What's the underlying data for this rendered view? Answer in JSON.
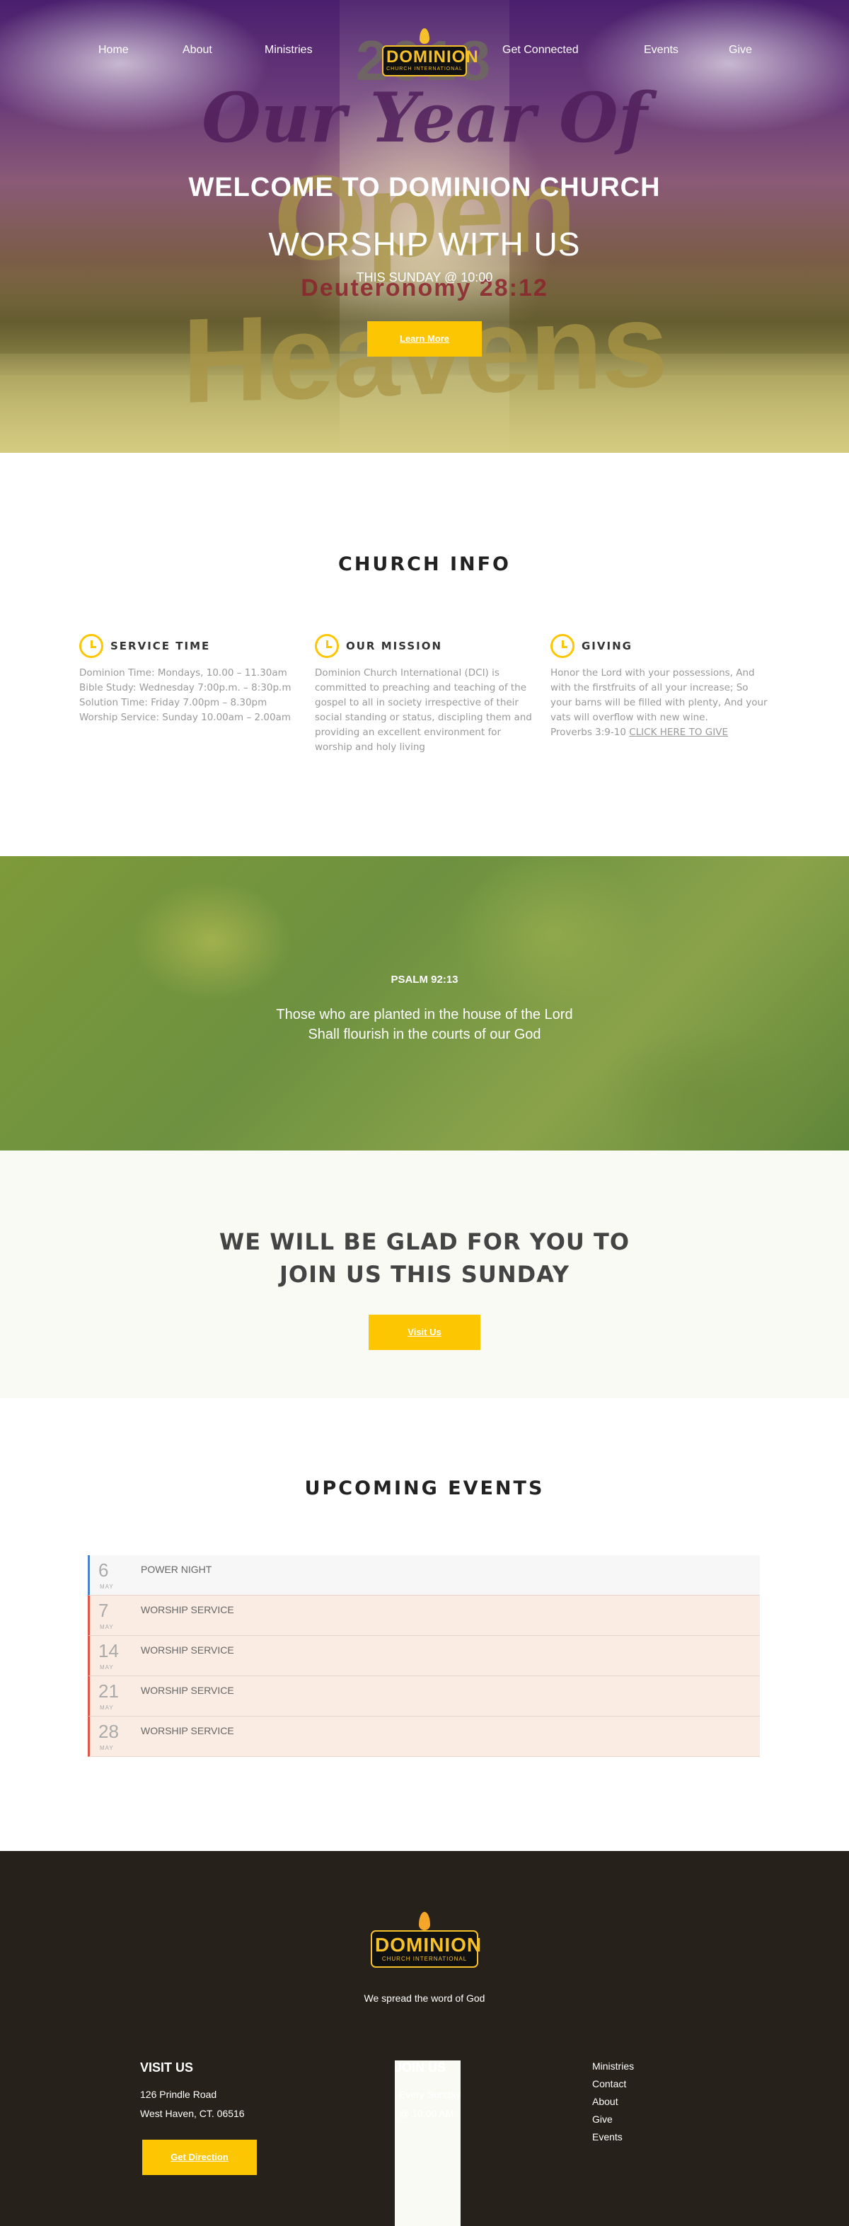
{
  "nav": {
    "home": "Home",
    "about": "About",
    "ministries": "Ministries",
    "get_connected": "Get Connected",
    "events": "Events",
    "give": "Give"
  },
  "logo": {
    "word": "DOMINION",
    "sub": "CHURCH INTERNATIONAL"
  },
  "hero": {
    "banner_year": "2018",
    "banner_script": "Our Year Of",
    "banner_title": "Open Heavens",
    "banner_verse": "Deuteronomy 28:12",
    "welcome": "WELCOME TO DOMINION CHURCH",
    "worship": "WORSHIP WITH US",
    "sunday": "THIS SUNDAY @ 10:00",
    "button": "Learn More"
  },
  "info": {
    "title": "CHURCH INFO",
    "service": {
      "heading": "SERVICE TIME",
      "lines": [
        "Dominion Time: Mondays, 10.00 – 11.30am",
        "Bible Study: Wednesday 7:00p.m. – 8:30p.m",
        "Solution Time: Friday 7.00pm – 8.30pm",
        "Worship Service: Sunday 10.00am – 2.00am"
      ]
    },
    "mission": {
      "heading": "OUR MISSION",
      "text": "Dominion Church International (DCI) is committed to preaching and teaching of the gospel to all in society irrespective of their social standing or status, discipling them and providing an excellent environment for worship and holy living"
    },
    "giving": {
      "heading": "GIVING",
      "text": "Honor the Lord with your possessions, And with the firstfruits of all your increase; So your barns will be filled with plenty, And your vats will overflow with new wine.",
      "ref": "Proverbs 3:9-10",
      "link": "CLICK HERE TO GIVE"
    }
  },
  "psalm": {
    "ref": "PSALM 92:13",
    "line1": "Those who are planted in the house of the Lord",
    "line2": "Shall flourish in the courts of our God"
  },
  "join": {
    "line1": "WE WILL BE GLAD FOR YOU TO",
    "line2": "JOIN US THIS SUNDAY",
    "button": "Visit Us"
  },
  "events": {
    "title": "UPCOMING EVENTS",
    "items": [
      {
        "day": "6",
        "month": "MAY",
        "name": "POWER NIGHT"
      },
      {
        "day": "7",
        "month": "MAY",
        "name": "WORSHIP SERVICE"
      },
      {
        "day": "14",
        "month": "MAY",
        "name": "WORSHIP SERVICE"
      },
      {
        "day": "21",
        "month": "MAY",
        "name": "WORSHIP SERVICE"
      },
      {
        "day": "28",
        "month": "MAY",
        "name": "WORSHIP SERVICE"
      }
    ]
  },
  "footer": {
    "tagline": "We spread the word of God",
    "visit": {
      "heading": "VISIT US",
      "line1": "126 Prindle Road",
      "line2": "West Haven, CT. 06516"
    },
    "join": {
      "heading": "JOIN US",
      "line1": "Every Sunday",
      "line2": "@ 10:00 AM"
    },
    "links": [
      "Ministries",
      "Contact",
      "About",
      "Give",
      "Events"
    ],
    "button": "Get Direction"
  },
  "colors": {
    "accent_yellow": "#fcc603",
    "footer_bg": "#26211b",
    "event_highlight": "#fbece3",
    "event_border_red": "#e0574a",
    "event_border_blue": "#4a83c8"
  }
}
